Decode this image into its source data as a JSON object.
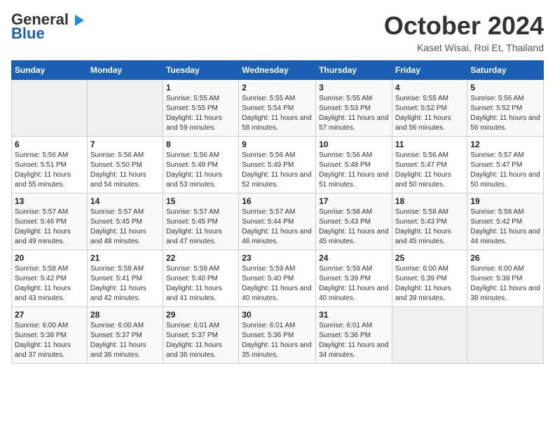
{
  "header": {
    "logo_line1": "General",
    "logo_line2": "Blue",
    "month": "October 2024",
    "location": "Kaset Wisai, Roi Et, Thailand"
  },
  "weekdays": [
    "Sunday",
    "Monday",
    "Tuesday",
    "Wednesday",
    "Thursday",
    "Friday",
    "Saturday"
  ],
  "weeks": [
    [
      {
        "day": "",
        "info": ""
      },
      {
        "day": "",
        "info": ""
      },
      {
        "day": "1",
        "info": "Sunrise: 5:55 AM\nSunset: 5:55 PM\nDaylight: 11 hours and 59 minutes."
      },
      {
        "day": "2",
        "info": "Sunrise: 5:55 AM\nSunset: 5:54 PM\nDaylight: 11 hours and 58 minutes."
      },
      {
        "day": "3",
        "info": "Sunrise: 5:55 AM\nSunset: 5:53 PM\nDaylight: 11 hours and 57 minutes."
      },
      {
        "day": "4",
        "info": "Sunrise: 5:55 AM\nSunset: 5:52 PM\nDaylight: 11 hours and 56 minutes."
      },
      {
        "day": "5",
        "info": "Sunrise: 5:56 AM\nSunset: 5:52 PM\nDaylight: 11 hours and 56 minutes."
      }
    ],
    [
      {
        "day": "6",
        "info": "Sunrise: 5:56 AM\nSunset: 5:51 PM\nDaylight: 11 hours and 55 minutes."
      },
      {
        "day": "7",
        "info": "Sunrise: 5:56 AM\nSunset: 5:50 PM\nDaylight: 11 hours and 54 minutes."
      },
      {
        "day": "8",
        "info": "Sunrise: 5:56 AM\nSunset: 5:49 PM\nDaylight: 11 hours and 53 minutes."
      },
      {
        "day": "9",
        "info": "Sunrise: 5:56 AM\nSunset: 5:49 PM\nDaylight: 11 hours and 52 minutes."
      },
      {
        "day": "10",
        "info": "Sunrise: 5:56 AM\nSunset: 5:48 PM\nDaylight: 11 hours and 51 minutes."
      },
      {
        "day": "11",
        "info": "Sunrise: 5:56 AM\nSunset: 5:47 PM\nDaylight: 11 hours and 50 minutes."
      },
      {
        "day": "12",
        "info": "Sunrise: 5:57 AM\nSunset: 5:47 PM\nDaylight: 11 hours and 50 minutes."
      }
    ],
    [
      {
        "day": "13",
        "info": "Sunrise: 5:57 AM\nSunset: 5:46 PM\nDaylight: 11 hours and 49 minutes."
      },
      {
        "day": "14",
        "info": "Sunrise: 5:57 AM\nSunset: 5:45 PM\nDaylight: 11 hours and 48 minutes."
      },
      {
        "day": "15",
        "info": "Sunrise: 5:57 AM\nSunset: 5:45 PM\nDaylight: 11 hours and 47 minutes."
      },
      {
        "day": "16",
        "info": "Sunrise: 5:57 AM\nSunset: 5:44 PM\nDaylight: 11 hours and 46 minutes."
      },
      {
        "day": "17",
        "info": "Sunrise: 5:58 AM\nSunset: 5:43 PM\nDaylight: 11 hours and 45 minutes."
      },
      {
        "day": "18",
        "info": "Sunrise: 5:58 AM\nSunset: 5:43 PM\nDaylight: 11 hours and 45 minutes."
      },
      {
        "day": "19",
        "info": "Sunrise: 5:58 AM\nSunset: 5:42 PM\nDaylight: 11 hours and 44 minutes."
      }
    ],
    [
      {
        "day": "20",
        "info": "Sunrise: 5:58 AM\nSunset: 5:42 PM\nDaylight: 11 hours and 43 minutes."
      },
      {
        "day": "21",
        "info": "Sunrise: 5:58 AM\nSunset: 5:41 PM\nDaylight: 11 hours and 42 minutes."
      },
      {
        "day": "22",
        "info": "Sunrise: 5:59 AM\nSunset: 5:40 PM\nDaylight: 11 hours and 41 minutes."
      },
      {
        "day": "23",
        "info": "Sunrise: 5:59 AM\nSunset: 5:40 PM\nDaylight: 11 hours and 40 minutes."
      },
      {
        "day": "24",
        "info": "Sunrise: 5:59 AM\nSunset: 5:39 PM\nDaylight: 11 hours and 40 minutes."
      },
      {
        "day": "25",
        "info": "Sunrise: 6:00 AM\nSunset: 5:39 PM\nDaylight: 11 hours and 39 minutes."
      },
      {
        "day": "26",
        "info": "Sunrise: 6:00 AM\nSunset: 5:38 PM\nDaylight: 11 hours and 38 minutes."
      }
    ],
    [
      {
        "day": "27",
        "info": "Sunrise: 6:00 AM\nSunset: 5:38 PM\nDaylight: 11 hours and 37 minutes."
      },
      {
        "day": "28",
        "info": "Sunrise: 6:00 AM\nSunset: 5:37 PM\nDaylight: 11 hours and 36 minutes."
      },
      {
        "day": "29",
        "info": "Sunrise: 6:01 AM\nSunset: 5:37 PM\nDaylight: 11 hours and 36 minutes."
      },
      {
        "day": "30",
        "info": "Sunrise: 6:01 AM\nSunset: 5:36 PM\nDaylight: 11 hours and 35 minutes."
      },
      {
        "day": "31",
        "info": "Sunrise: 6:01 AM\nSunset: 5:36 PM\nDaylight: 11 hours and 34 minutes."
      },
      {
        "day": "",
        "info": ""
      },
      {
        "day": "",
        "info": ""
      }
    ]
  ]
}
